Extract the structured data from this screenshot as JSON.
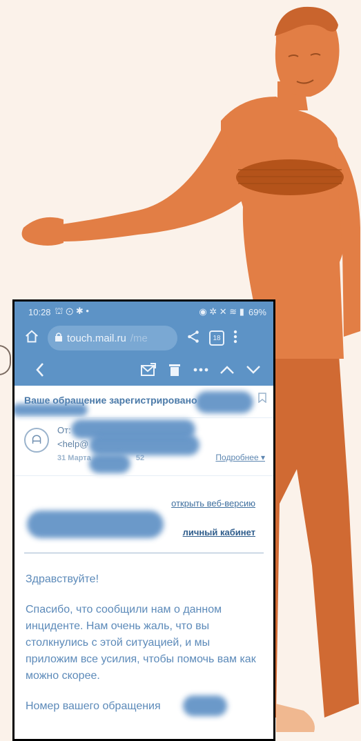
{
  "colors": {
    "background": "#fbf2ea",
    "man_orange": "#e27e45",
    "phone_bar": "#5d93c6",
    "link": "#3f6f9e"
  },
  "status_bar": {
    "time": "10:28",
    "left_icons": "⛫ ⊙ ✱ •",
    "right_icons": "◉ ✲ ✕ ≋ ▮",
    "battery": "69%"
  },
  "browser": {
    "home_icon": "home-icon",
    "url_host": "touch.mail.ru",
    "url_path": "/me",
    "tabs_count": "18"
  },
  "toolbar": {
    "back_icon": "chevron-left-icon",
    "move_icon": "move-to-icon",
    "delete_icon": "trash-icon",
    "more_icon": "more-icon",
    "prev_icon": "chevron-up-icon",
    "next_icon": "chevron-down-icon"
  },
  "email": {
    "subject": "Ваше обращение зарегистрировано",
    "from_label": "От:",
    "from_address": "<help@",
    "date": "31 Марта",
    "date_tail": "52",
    "more_link": "Подробнее ▾"
  },
  "links": {
    "web_version": "открыть веб-версию",
    "cabinet": "личный кабинет"
  },
  "body": {
    "greeting": "Здравствуйте!",
    "paragraph": "Спасибо, что сообщили нам о данном инциденте. Нам очень жаль, что вы столкнулись с этой ситуацией, и мы приложим все усилия, чтобы помочь вам как можно скорее.",
    "ticket_line": "Номер вашего обращения"
  }
}
